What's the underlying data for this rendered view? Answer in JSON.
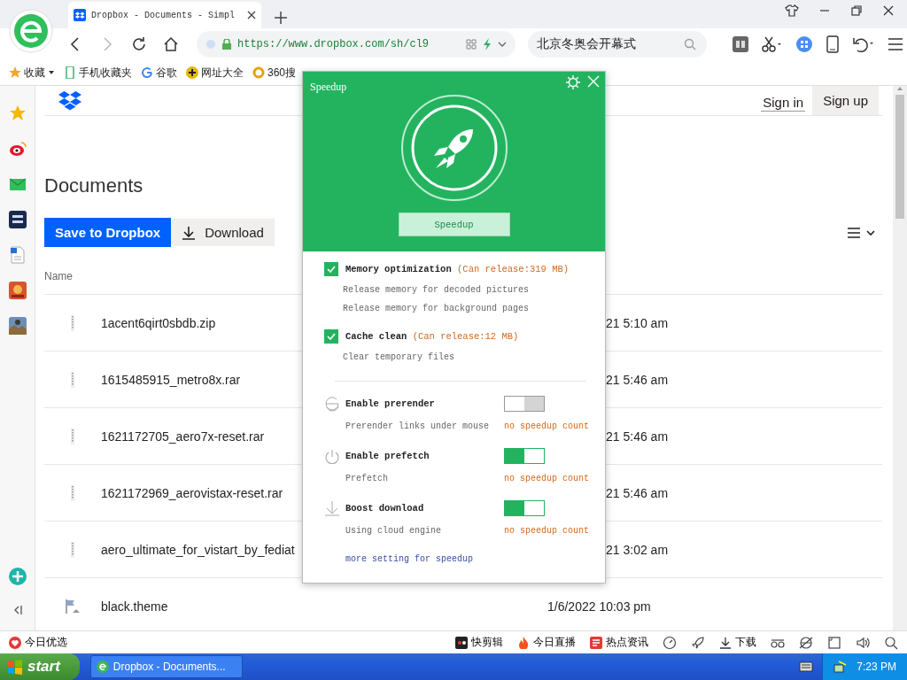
{
  "browser": {
    "tab": {
      "title": "Dropbox - Documents - Simpl",
      "selected": true
    },
    "address": "https://www.dropbox.com/sh/cl9",
    "search": {
      "value": "北京冬奥会开幕式"
    },
    "bookmarks": [
      {
        "label": "收藏",
        "kind": "star"
      },
      {
        "label": "手机收藏夹",
        "kind": "phone"
      },
      {
        "label": "谷歌",
        "kind": "google"
      },
      {
        "label": "网址大全",
        "kind": "plus"
      },
      {
        "label": "360搜",
        "kind": "ring"
      }
    ]
  },
  "page": {
    "title": "Documents",
    "primary_action": "Save to Dropbox",
    "secondary_action": "Download",
    "header_links": [
      {
        "label": "Sign in",
        "kind": "link"
      },
      {
        "label": "Sign up",
        "kind": "button"
      }
    ],
    "columns": [
      "Name"
    ],
    "rows": [
      {
        "name": "1acent6qirt0sbdb.zip",
        "modified": "21 5:10 am",
        "modified_covered": true,
        "kind": "archive"
      },
      {
        "name": "1615485915_metro8x.rar",
        "modified": "21 5:46 am",
        "modified_covered": true,
        "kind": "archive"
      },
      {
        "name": "1621172705_aero7x-reset.rar",
        "modified": "21 5:46 am",
        "modified_covered": true,
        "kind": "archive"
      },
      {
        "name": "1621172969_aerovistax-reset.rar",
        "modified": "21 5:46 am",
        "modified_covered": true,
        "kind": "archive"
      },
      {
        "name": "aero_ultimate_for_vistart_by_fediat",
        "modified": "21 3:02 am",
        "modified_covered": true,
        "kind": "archive"
      },
      {
        "name": "black.theme",
        "modified": "1/6/2022 10:03 pm",
        "modified_covered": false,
        "kind": "theme"
      }
    ]
  },
  "popup": {
    "title": "Speedup",
    "button": "Speedup",
    "options": [
      {
        "label": "Memory optimization",
        "note": "(Can release:319 MB)",
        "checked": true,
        "details": [
          "Release memory for decoded pictures",
          "Release memory for background pages"
        ]
      },
      {
        "label": "Cache clean",
        "note": "(Can release:12 MB)",
        "checked": true,
        "details": [
          "Clear temporary files"
        ]
      }
    ],
    "switches": [
      {
        "kind": "prerender",
        "label": "Enable prerender",
        "description": "Prerender links under mouse",
        "count": "no speedup count",
        "on": false
      },
      {
        "kind": "prefetch",
        "label": "Enable prefetch",
        "description": "Prefetch",
        "count": "no speedup count",
        "on": true
      },
      {
        "kind": "download",
        "label": "Boost download",
        "description": "Using cloud engine",
        "count": "no speedup count",
        "on": true
      }
    ],
    "link": "more setting for speedup"
  },
  "status_bar": {
    "left": "今日优选",
    "items": [
      {
        "label": "快剪辑",
        "kind": "clip"
      },
      {
        "label": "今日直播",
        "kind": "flame"
      },
      {
        "label": "热点资讯",
        "kind": "news"
      },
      {
        "label": "下载",
        "kind": "download"
      }
    ]
  },
  "taskbar": {
    "start": "start",
    "window": "Dropbox - Documents...",
    "clock": "7:23 PM"
  }
}
